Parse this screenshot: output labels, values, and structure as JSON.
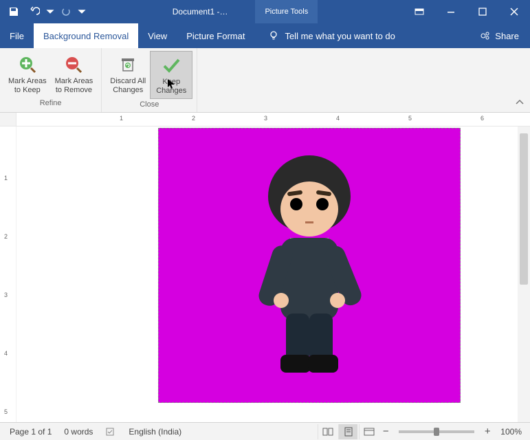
{
  "titlebar": {
    "doc_title": "Document1  -…",
    "context_tab": "Picture Tools"
  },
  "tabs": {
    "file": "File",
    "bgremoval": "Background Removal",
    "view": "View",
    "picfmt": "Picture Format",
    "tellme": "Tell me what you want to do",
    "share": "Share"
  },
  "ribbon": {
    "mark_keep": "Mark Areas\nto Keep",
    "mark_remove": "Mark Areas\nto Remove",
    "refine_group": "Refine",
    "discard": "Discard All\nChanges",
    "keep": "Keep\nChanges",
    "close_group": "Close"
  },
  "ruler": {
    "n1": "1",
    "n2": "2",
    "n3": "3",
    "n4": "4",
    "n5": "5",
    "n6": "6"
  },
  "vruler": {
    "n1": "1",
    "n2": "2",
    "n3": "3",
    "n4": "4",
    "n5": "5"
  },
  "status": {
    "page": "Page 1 of 1",
    "words": "0 words",
    "lang": "English (India)",
    "zoom": "100%"
  }
}
